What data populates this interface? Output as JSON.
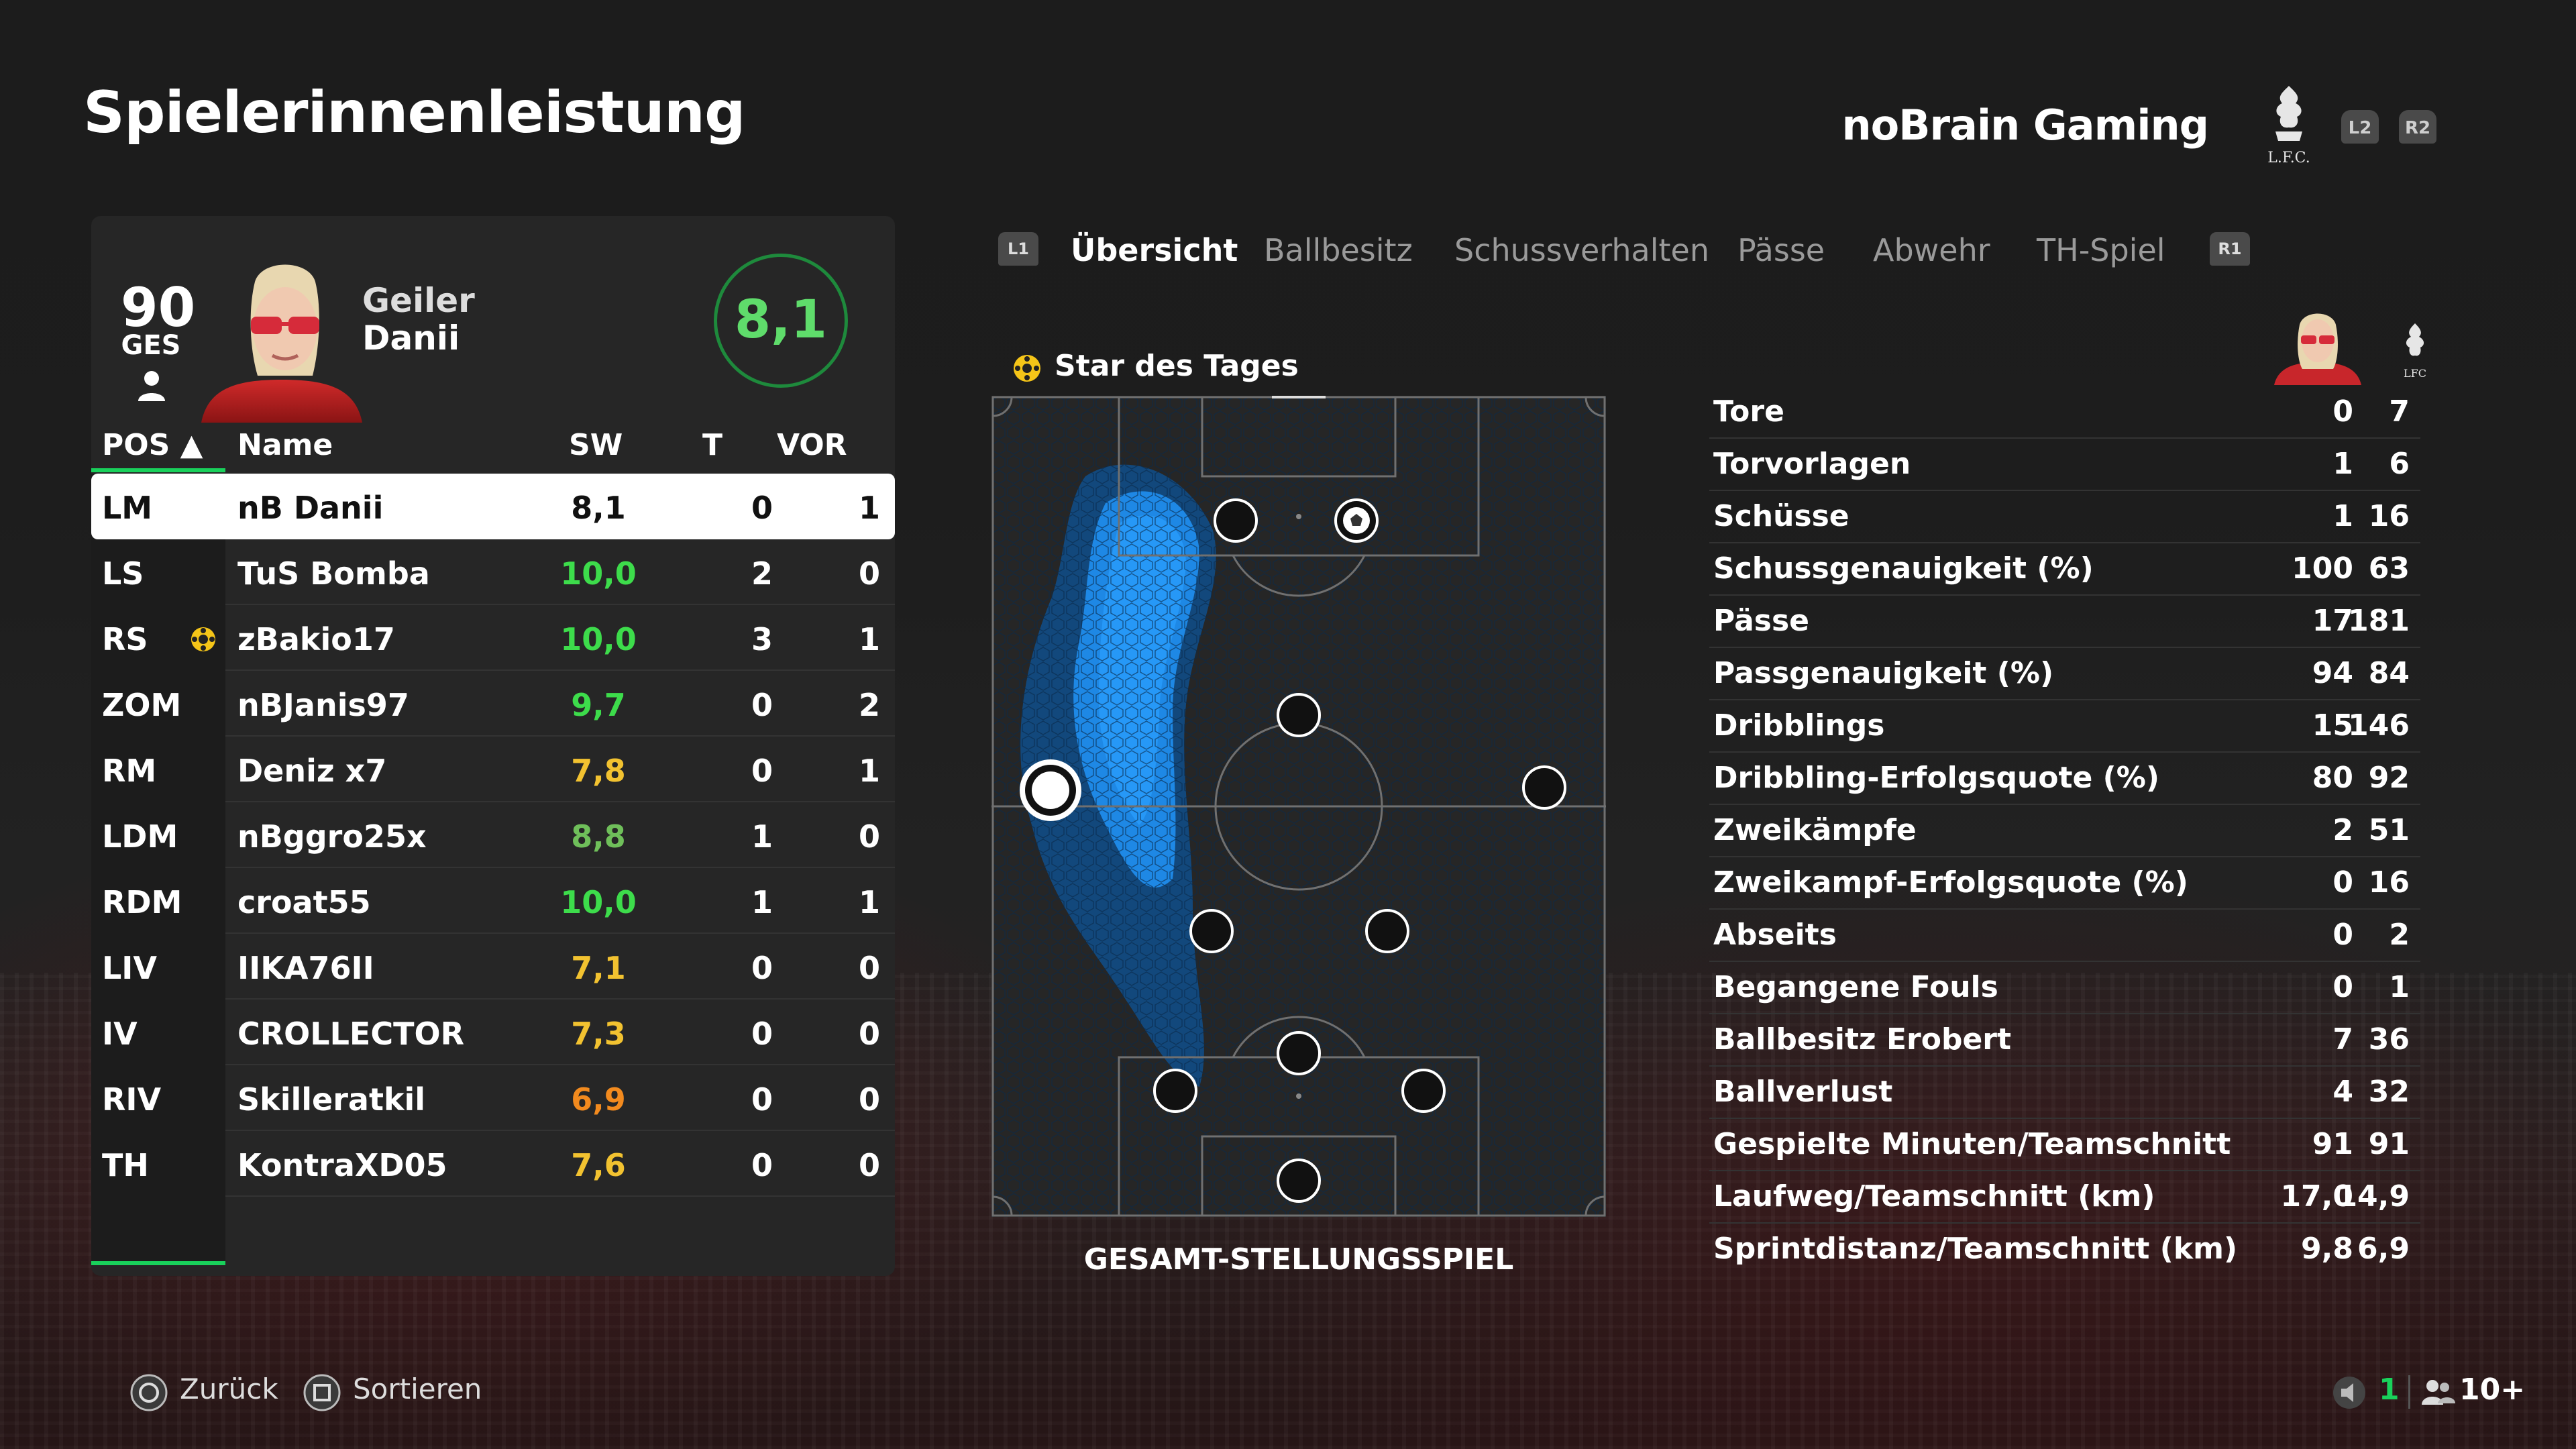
{
  "header": {
    "title": "Spielerinnenleistung",
    "club_name": "noBrain Gaming",
    "trigger_left": "L2",
    "trigger_right": "R2"
  },
  "player": {
    "ovr": "90",
    "ovr_label": "GES",
    "first_name": "Geiler",
    "last_name": "Danii",
    "rating": "8,1"
  },
  "table": {
    "headers": {
      "pos": "POS ▲",
      "name": "Name",
      "sw": "SW",
      "t": "T",
      "vor": "VOR"
    },
    "rows": [
      {
        "pos": "LM",
        "name": "nB Danii",
        "sw": "8,1",
        "t": "0",
        "vor": "1",
        "color": "#111111",
        "selected": true
      },
      {
        "pos": "LS",
        "name": "TuS Bomba",
        "sw": "10,0",
        "t": "2",
        "vor": "0",
        "color": "#3ddc4b"
      },
      {
        "pos": "RS",
        "name": "zBakio17",
        "sw": "10,0",
        "t": "3",
        "vor": "1",
        "color": "#3ddc4b",
        "star": true
      },
      {
        "pos": "ZOM",
        "name": "nBJanis97",
        "sw": "9,7",
        "t": "0",
        "vor": "2",
        "color": "#3ddc4b"
      },
      {
        "pos": "RM",
        "name": "Deniz x7",
        "sw": "7,8",
        "t": "0",
        "vor": "1",
        "color": "#f2c230"
      },
      {
        "pos": "LDM",
        "name": "nBggro25x",
        "sw": "8,8",
        "t": "1",
        "vor": "0",
        "color": "#6fbf5a"
      },
      {
        "pos": "RDM",
        "name": "croat55",
        "sw": "10,0",
        "t": "1",
        "vor": "1",
        "color": "#3ddc4b"
      },
      {
        "pos": "LIV",
        "name": "IIKA76II",
        "sw": "7,1",
        "t": "0",
        "vor": "0",
        "color": "#f2c230"
      },
      {
        "pos": "IV",
        "name": "CROLLECTOR",
        "sw": "7,3",
        "t": "0",
        "vor": "0",
        "color": "#f2c230"
      },
      {
        "pos": "RIV",
        "name": "Skilleratkil",
        "sw": "6,9",
        "t": "0",
        "vor": "0",
        "color": "#f28a1e"
      },
      {
        "pos": "TH",
        "name": "KontraXD05",
        "sw": "7,6",
        "t": "0",
        "vor": "0",
        "color": "#f2c230"
      }
    ]
  },
  "tabs": {
    "left_button": "L1",
    "right_button": "R1",
    "items": [
      "Übersicht",
      "Ballbesitz",
      "Schussverhalten",
      "Pässe",
      "Abwehr",
      "TH-Spiel"
    ],
    "active": 0
  },
  "star_of_day": "Star des Tages",
  "pitch_label": "GESAMT-STELLUNGSSPIEL",
  "stats": [
    {
      "label": "Tore",
      "player": "0",
      "team": "7"
    },
    {
      "label": "Torvorlagen",
      "player": "1",
      "team": "6"
    },
    {
      "label": "Schüsse",
      "player": "1",
      "team": "16"
    },
    {
      "label": "Schussgenauigkeit (%)",
      "player": "100",
      "team": "63"
    },
    {
      "label": "Pässe",
      "player": "17",
      "team": "181"
    },
    {
      "label": "Passgenauigkeit (%)",
      "player": "94",
      "team": "84"
    },
    {
      "label": "Dribblings",
      "player": "15",
      "team": "146"
    },
    {
      "label": "Dribbling-Erfolgsquote (%)",
      "player": "80",
      "team": "92"
    },
    {
      "label": "Zweikämpfe",
      "player": "2",
      "team": "51"
    },
    {
      "label": "Zweikampf-Erfolgsquote (%)",
      "player": "0",
      "team": "16"
    },
    {
      "label": "Abseits",
      "player": "0",
      "team": "2"
    },
    {
      "label": "Begangene Fouls",
      "player": "0",
      "team": "1"
    },
    {
      "label": "Ballbesitz Erobert",
      "player": "7",
      "team": "36"
    },
    {
      "label": "Ballverlust",
      "player": "4",
      "team": "32"
    },
    {
      "label": "Gespielte Minuten/Teamschnitt",
      "player": "91",
      "team": "91"
    },
    {
      "label": "Laufweg/Teamschnitt (km)",
      "player": "17,0",
      "team": "14,9"
    },
    {
      "label": "Sprintdistanz/Teamschnitt (km)",
      "player": "9,8",
      "team": "6,9"
    }
  ],
  "footer": {
    "back_label": "Zurück",
    "sort_label": "Sortieren",
    "voice_count": "1",
    "players_count": "10+"
  },
  "colors": {
    "accent": "#19d15b",
    "heatmap": "#1e88e5"
  }
}
